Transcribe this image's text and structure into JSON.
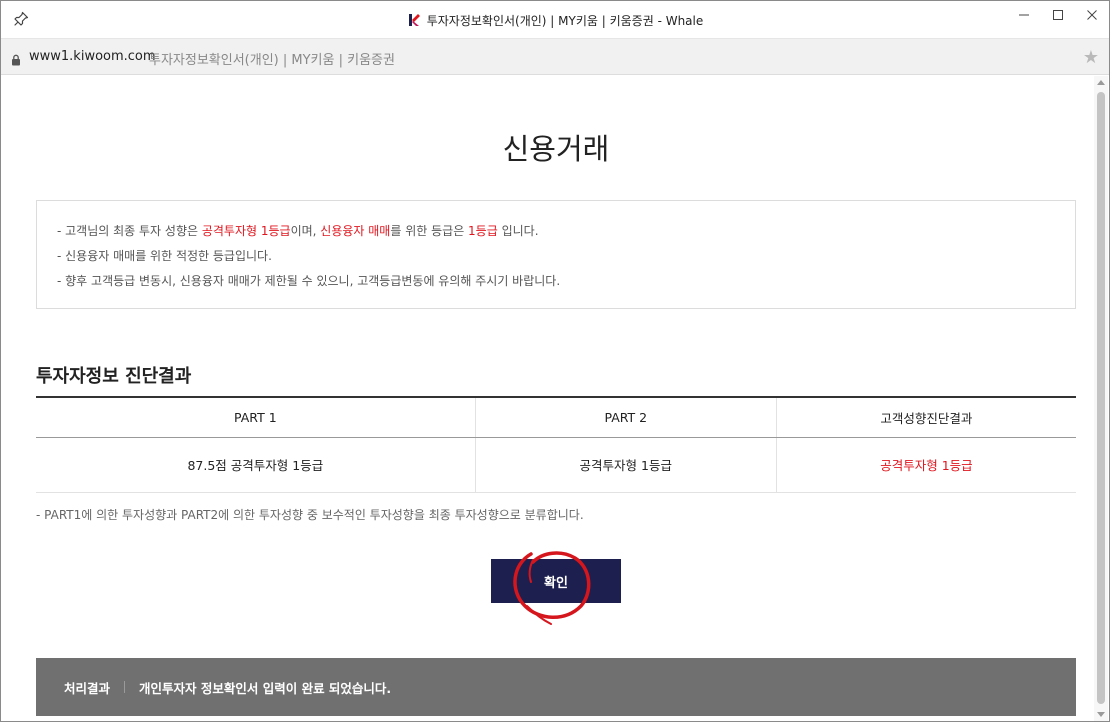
{
  "window": {
    "title": "투자자정보확인서(개인) | MY키움 | 키움증권 - Whale",
    "controls": [
      "minimize-icon",
      "maximize-icon",
      "close-icon"
    ]
  },
  "address_bar": {
    "domain": "www1.kiwoom.com",
    "page_title": "투자자정보확인서(개인) | MY키움 | 키움증권"
  },
  "page": {
    "title": "신용거래",
    "notice": {
      "line1": {
        "prefix": "- 고객님의 최종 투자 성향은 ",
        "grade": "공격투자형 1등급",
        "mid1": "이며, ",
        "credit": "신용융자 매매",
        "mid2": "를 위한 등급은 ",
        "level": "1등급",
        "suffix": " 입니다."
      },
      "line2": "- 신용융자 매매를 위한 적정한 등급입니다.",
      "line3": "- 향후 고객등급 변동시, 신용융자 매매가 제한될 수 있으니, 고객등급변동에 유의해 주시기 바랍니다."
    },
    "section_title": "투자자정보 진단결과",
    "table": {
      "headers": [
        "PART 1",
        "PART 2",
        "고객성향진단결과"
      ],
      "row": [
        "87.5점 공격투자형 1등급",
        "공격투자형 1등급",
        "공격투자형 1등급"
      ]
    },
    "footnote": "- PART1에 의한 투자성향과 PART2에 의한 투자성향 중 보수적인 투자성향을 최종 투자성향으로 분류합니다.",
    "confirm_label": "확인",
    "result_bar": {
      "label": "처리결과",
      "message": "개인투자자 정보확인서 입력이 완료 되었습니다."
    }
  },
  "colors": {
    "accent_red": "#e0161f",
    "button_navy": "#1d1f4e",
    "result_bar_gray": "#707070"
  }
}
